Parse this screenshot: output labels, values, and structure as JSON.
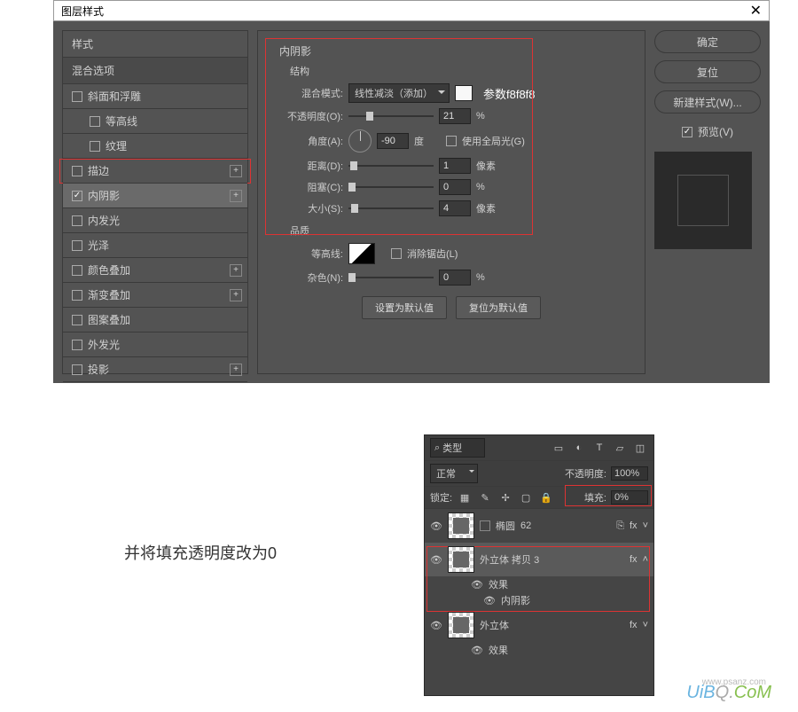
{
  "dialog": {
    "title": "图层样式",
    "close": "✕",
    "styles_header": "样式",
    "blend_options": "混合选项",
    "items": [
      {
        "label": "斜面和浮雕",
        "checked": false,
        "indent": false,
        "plus": false
      },
      {
        "label": "等高线",
        "checked": false,
        "indent": true,
        "plus": false
      },
      {
        "label": "纹理",
        "checked": false,
        "indent": true,
        "plus": false
      },
      {
        "label": "描边",
        "checked": false,
        "indent": false,
        "plus": true
      },
      {
        "label": "内阴影",
        "checked": true,
        "indent": false,
        "plus": true,
        "selected": true
      },
      {
        "label": "内发光",
        "checked": false,
        "indent": false,
        "plus": false
      },
      {
        "label": "光泽",
        "checked": false,
        "indent": false,
        "plus": false
      },
      {
        "label": "颜色叠加",
        "checked": false,
        "indent": false,
        "plus": true
      },
      {
        "label": "渐变叠加",
        "checked": false,
        "indent": false,
        "plus": true
      },
      {
        "label": "图案叠加",
        "checked": false,
        "indent": false,
        "plus": false
      },
      {
        "label": "外发光",
        "checked": false,
        "indent": false,
        "plus": false
      },
      {
        "label": "投影",
        "checked": false,
        "indent": false,
        "plus": true
      }
    ]
  },
  "settings": {
    "section": "内阴影",
    "structure": "结构",
    "blend_mode_label": "混合模式:",
    "blend_mode_value": "线性减淡（添加）",
    "swatch_color": "#f8f8f8",
    "param_note": "参数f8f8f8",
    "opacity_label": "不透明度(O):",
    "opacity_value": "21",
    "opacity_unit": "%",
    "angle_label": "角度(A):",
    "angle_value": "-90",
    "angle_unit": "度",
    "global_light": "使用全局光(G)",
    "distance_label": "距离(D):",
    "distance_value": "1",
    "distance_unit": "像素",
    "choke_label": "阻塞(C):",
    "choke_value": "0",
    "choke_unit": "%",
    "size_label": "大小(S):",
    "size_value": "4",
    "size_unit": "像素",
    "quality": "品质",
    "contour_label": "等高线:",
    "antialias": "消除锯齿(L)",
    "noise_label": "杂色(N):",
    "noise_value": "0",
    "noise_unit": "%",
    "set_default": "设置为默认值",
    "reset_default": "复位为默认值"
  },
  "buttons": {
    "ok": "确定",
    "reset": "复位",
    "new_style": "新建样式(W)...",
    "preview": "预览(V)"
  },
  "caption": "并将填充透明度改为0",
  "layers_panel": {
    "search_icon": "⌕",
    "kind": "类型",
    "blend": "正常",
    "opacity_label": "不透明度:",
    "opacity_value": "100%",
    "lock_label": "锁定:",
    "fill_label": "填充:",
    "fill_value": "0%",
    "items": [
      {
        "name": "椭圆",
        "suffix": "62",
        "fx": true,
        "link": true
      },
      {
        "name": "外立体 拷贝 3",
        "fx": true,
        "expanded": true
      },
      {
        "name": "外立体",
        "fx": true
      }
    ],
    "fx_label": "效果",
    "inner_shadow": "内阴影",
    "fx_badge": "fx"
  },
  "watermark": {
    "text1": "UiB",
    "text2": "Q.",
    "text3": "CoM",
    "sub": "www.psanz.com"
  }
}
